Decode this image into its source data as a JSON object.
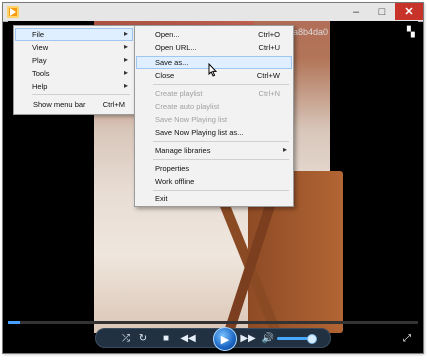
{
  "window": {
    "title_fragment": "2a8b4da0",
    "buttons": {
      "minimize": "–",
      "maximize": "□",
      "close": "✕"
    }
  },
  "menu": {
    "items": [
      {
        "label": "File",
        "arrow": "▸"
      },
      {
        "label": "View",
        "arrow": "▸"
      },
      {
        "label": "Play",
        "arrow": "▸"
      },
      {
        "label": "Tools",
        "arrow": "▸"
      },
      {
        "label": "Help",
        "arrow": "▸"
      }
    ],
    "show_menu_bar": {
      "label": "Show menu bar",
      "shortcut": "Ctrl+M"
    }
  },
  "file_menu": {
    "items": [
      {
        "label": "Open...",
        "shortcut": "Ctrl+O"
      },
      {
        "label": "Open URL...",
        "shortcut": "Ctrl+U"
      },
      {
        "label": "Save as...",
        "shortcut": ""
      },
      {
        "label": "Close",
        "shortcut": "Ctrl+W"
      },
      {
        "label": "Create playlist",
        "shortcut": "Ctrl+N"
      },
      {
        "label": "Create auto playlist",
        "shortcut": ""
      },
      {
        "label": "Save Now Playing list",
        "shortcut": ""
      },
      {
        "label": "Save Now Playing list as...",
        "shortcut": ""
      },
      {
        "label": "Manage libraries",
        "shortcut": "",
        "arrow": "▸"
      },
      {
        "label": "Properties",
        "shortcut": ""
      },
      {
        "label": "Work offline",
        "shortcut": ""
      },
      {
        "label": "Exit",
        "shortcut": ""
      }
    ]
  },
  "player": {
    "progress": 0.03,
    "volume": 0.85,
    "icons": {
      "shuffle": "⤮",
      "repeat": "↻",
      "stop": "■",
      "previous": "◀◀",
      "play": "▶",
      "next": "▶▶",
      "volume": "🔊",
      "switch_to_library": "▚",
      "fullscreen": "⤢"
    }
  }
}
